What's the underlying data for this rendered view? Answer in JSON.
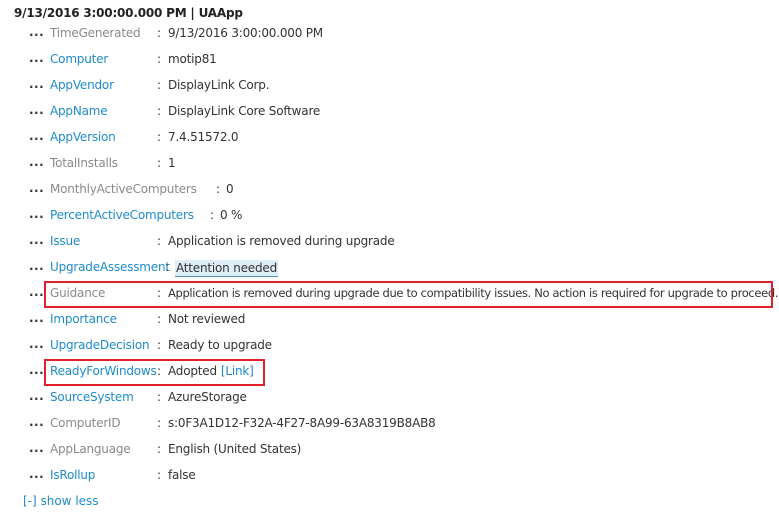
{
  "record": {
    "header": "9/13/2016 3:00:00.000 PM | UAApp"
  },
  "expander_glyph": "...",
  "colon": ":",
  "fields": [
    {
      "name": "TimeGenerated",
      "value": "9/13/2016 3:00:00.000 PM",
      "name_link": false
    },
    {
      "name": "Computer",
      "value": "motip81",
      "name_link": true
    },
    {
      "name": "AppVendor",
      "value": "DisplayLink Corp.",
      "name_link": true
    },
    {
      "name": "AppName",
      "value": "DisplayLink Core Software",
      "name_link": true
    },
    {
      "name": "AppVersion",
      "value": "7.4.51572.0",
      "name_link": true
    },
    {
      "name": "TotalInstalls",
      "value": "1",
      "name_link": false
    },
    {
      "name": "MonthlyActiveComputers",
      "value": "0",
      "name_link": false
    },
    {
      "name": "PercentActiveComputers",
      "value": "0 %",
      "name_link": true
    },
    {
      "name": "Issue",
      "value": "Application is removed during upgrade",
      "name_link": true
    },
    {
      "name": "UpgradeAssessment",
      "value": "Attention needed",
      "name_link": true
    },
    {
      "name": "Guidance",
      "value": "Application is removed during upgrade due to compatibility issues. No action is required for upgrade to proceed.",
      "name_link": false
    },
    {
      "name": "Importance",
      "value": "Not reviewed",
      "name_link": true
    },
    {
      "name": "UpgradeDecision",
      "value": "Ready to upgrade",
      "name_link": true
    },
    {
      "name": "ReadyForWindows",
      "value": "Adopted",
      "link_text": "[Link]",
      "name_link": true
    },
    {
      "name": "SourceSystem",
      "value": "AzureStorage",
      "name_link": true
    },
    {
      "name": "ComputerID",
      "value": "s:0F3A1D12-F32A-4F27-8A99-63A8319B8AB8",
      "name_link": false
    },
    {
      "name": "AppLanguage",
      "value": "English (United States)",
      "name_link": false
    },
    {
      "name": "IsRollup",
      "value": "false",
      "name_link": true
    }
  ],
  "footer": {
    "show_less": "[-] show less"
  },
  "colors": {
    "link": "#1e8bcd",
    "muted_field": "#8a8a8a",
    "highlight_border": "#e0202a",
    "chip_background": "#deeef8"
  }
}
